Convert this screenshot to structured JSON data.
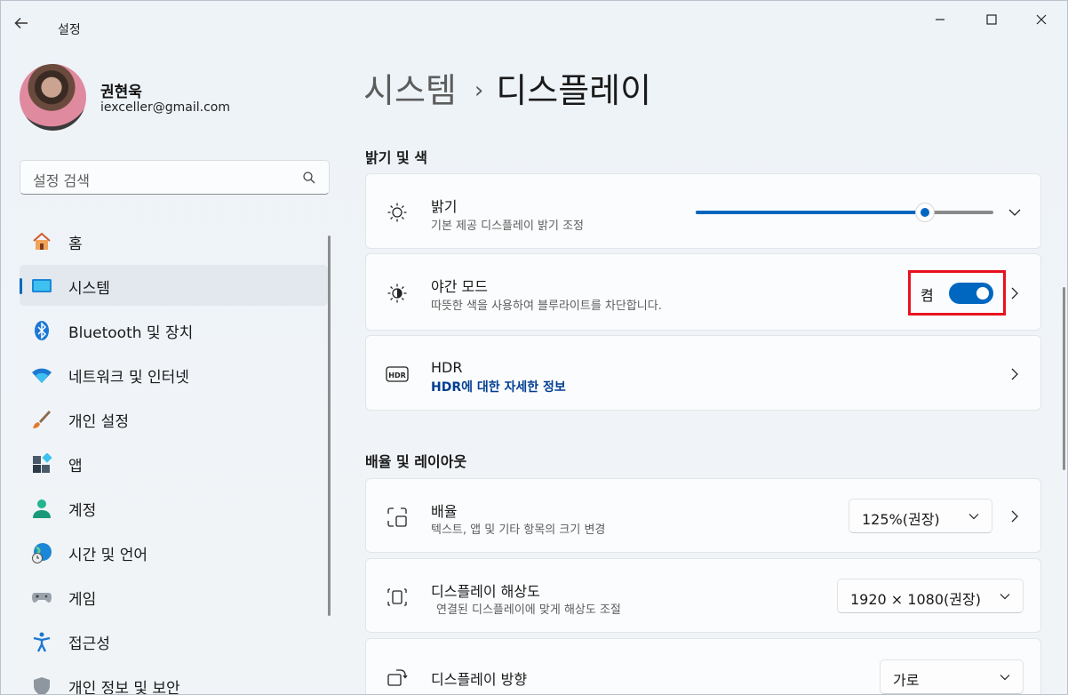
{
  "window": {
    "app_title": "설정",
    "controls": {
      "minimize": "minimize",
      "maximize": "maximize",
      "close": "close"
    }
  },
  "profile": {
    "name": "권현욱",
    "email": "iexceller@gmail.com"
  },
  "search": {
    "placeholder": "설정 검색"
  },
  "sidebar": {
    "items": [
      {
        "label": "홈",
        "icon": "home-icon"
      },
      {
        "label": "시스템",
        "icon": "system-icon",
        "active": true
      },
      {
        "label": "Bluetooth 및 장치",
        "icon": "bluetooth-icon"
      },
      {
        "label": "네트워크 및 인터넷",
        "icon": "wifi-icon"
      },
      {
        "label": "개인 설정",
        "icon": "brush-icon"
      },
      {
        "label": "앱",
        "icon": "apps-icon"
      },
      {
        "label": "계정",
        "icon": "account-icon"
      },
      {
        "label": "시간 및 언어",
        "icon": "globe-clock-icon"
      },
      {
        "label": "게임",
        "icon": "gamepad-icon"
      },
      {
        "label": "접근성",
        "icon": "accessibility-icon"
      },
      {
        "label": "개인 정보 및 보안",
        "icon": "shield-icon"
      }
    ]
  },
  "breadcrumb": {
    "parent": "시스템",
    "separator": "›",
    "current": "디스플레이"
  },
  "sections": {
    "brightness_color": {
      "title": "밝기 및 색",
      "brightness": {
        "title": "밝기",
        "subtitle": "기본 제공 디스플레이 밝기 조정",
        "level_percent": 77
      },
      "night_light": {
        "title": "야간 모드",
        "subtitle": "따뜻한 색을 사용하여 블루라이트를 차단합니다.",
        "state_label": "켬",
        "on": true
      },
      "hdr": {
        "title": "HDR",
        "link": "HDR에 대한 자세한 정보"
      }
    },
    "scale_layout": {
      "title": "배율 및 레이아웃",
      "scale": {
        "title": "배율",
        "subtitle": "텍스트, 앱 및 기타 항목의 크기 변경",
        "value": "125%(권장)"
      },
      "resolution": {
        "title": "디스플레이 해상도",
        "subtitle": "연결된 디스플레이에 맞게 해상도 조절",
        "value": "1920 × 1080(권장)"
      },
      "orientation": {
        "title": "디스플레이 방향",
        "value": "가로"
      }
    }
  },
  "colors": {
    "accent": "#0067c0",
    "highlight": "#e8121e",
    "link": "#003e92"
  }
}
